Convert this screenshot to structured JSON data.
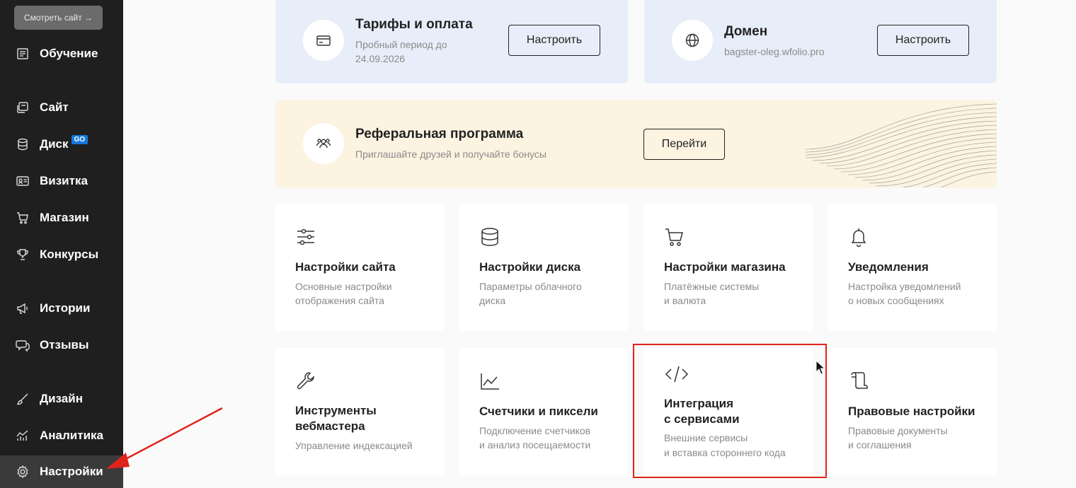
{
  "sidebar": {
    "view_site": "Смотреть сайт →",
    "items": [
      {
        "label": "Обучение",
        "icon": "book-icon"
      },
      {
        "label": "Сайт",
        "icon": "pages-icon"
      },
      {
        "label": "Диск",
        "icon": "database-icon",
        "badge": "GO"
      },
      {
        "label": "Визитка",
        "icon": "id-card-icon"
      },
      {
        "label": "Магазин",
        "icon": "cart-icon"
      },
      {
        "label": "Конкурсы",
        "icon": "trophy-icon"
      },
      {
        "label": "Истории",
        "icon": "megaphone-icon"
      },
      {
        "label": "Отзывы",
        "icon": "chat-icon"
      },
      {
        "label": "Дизайн",
        "icon": "brush-icon"
      },
      {
        "label": "Аналитика",
        "icon": "analytics-icon"
      },
      {
        "label": "Настройки",
        "icon": "gear-icon",
        "active": true
      }
    ]
  },
  "cards": {
    "tariffs": {
      "title": "Тарифы и оплата",
      "sub1": "Пробный период до",
      "sub2": "24.09.2026",
      "button": "Настроить"
    },
    "domain": {
      "title": "Домен",
      "sub": "bagster-oleg.wfolio.pro",
      "button": "Настроить"
    },
    "referral": {
      "title": "Реферальная программа",
      "sub": "Приглашайте друзей и получайте бонусы",
      "button": "Перейти"
    }
  },
  "tiles": [
    {
      "title": "Настройки сайта",
      "sub1": "Основные настройки",
      "sub2": "отображения сайта"
    },
    {
      "title": "Настройки диска",
      "sub1": "Параметры облачного",
      "sub2": "диска"
    },
    {
      "title": "Настройки магазина",
      "sub1": "Платёжные системы",
      "sub2": "и валюта"
    },
    {
      "title": "Уведомления",
      "sub1": "Настройка уведомлений",
      "sub2": "о новых сообщениях"
    },
    {
      "title1": "Инструменты",
      "title2": "вебмастера",
      "sub1": "Управление индексацией"
    },
    {
      "title": "Счетчики и пиксели",
      "sub1": "Подключение счетчиков",
      "sub2": "и анализ посещаемости"
    },
    {
      "title1": "Интеграция",
      "title2": "с сервисами",
      "sub1": "Внешние сервисы",
      "sub2": "и вставка стороннего кода"
    },
    {
      "title": "Правовые настройки",
      "sub1": "Правовые документы",
      "sub2": "и соглашения"
    }
  ],
  "colors": {
    "sidebar_bg": "#1f1f1f",
    "card_blue": "#e8eef9",
    "card_yellow": "#fdf3e1",
    "badge": "#1479d8",
    "annotation_red": "#e0231b"
  }
}
